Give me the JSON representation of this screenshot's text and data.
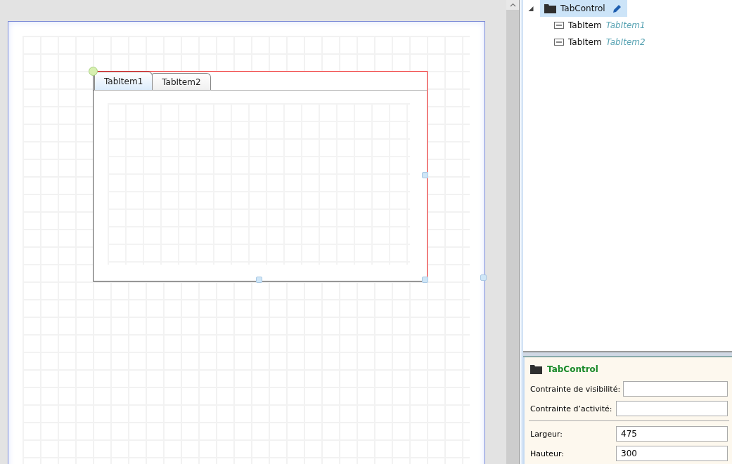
{
  "canvas": {
    "tab_control": {
      "tabs": [
        {
          "label": "TabItem1",
          "selected": true
        },
        {
          "label": "TabItem2",
          "selected": false
        }
      ]
    }
  },
  "tree": {
    "root": {
      "label": "TabControl",
      "expanded": true,
      "selected": true,
      "children": [
        {
          "type": "TabItem",
          "name": "TabItem1"
        },
        {
          "type": "TabItem",
          "name": "TabItem2"
        }
      ]
    }
  },
  "properties": {
    "title": "TabControl",
    "groups": [
      [
        {
          "label": "Contrainte de visibilité:"
        },
        {
          "label": "Contrainte d’activité:"
        }
      ],
      [
        {
          "label": "Largeur:",
          "value": "475"
        },
        {
          "label": "Hauteur:",
          "value": "300"
        }
      ]
    ]
  }
}
